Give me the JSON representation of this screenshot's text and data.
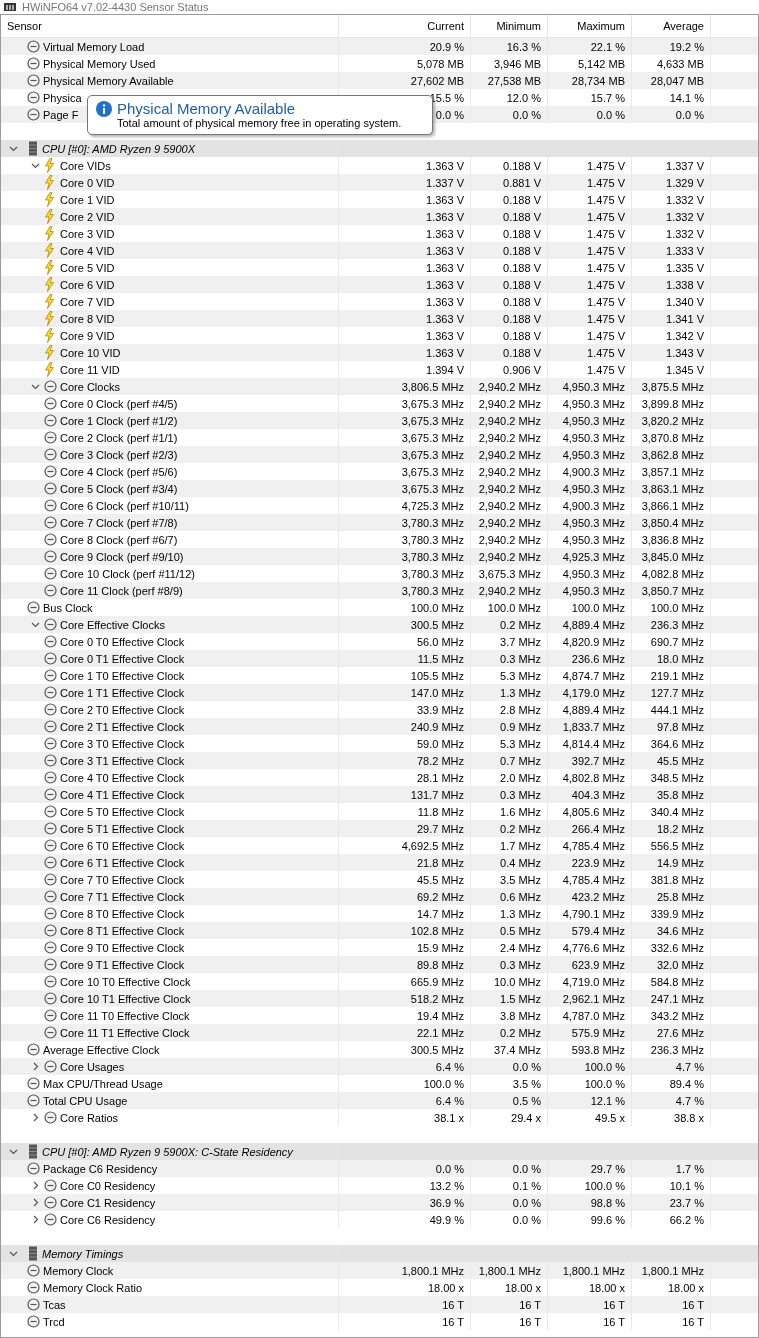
{
  "window": {
    "title": "HWiNFO64 v7.02-4430 Sensor Status"
  },
  "columns": [
    "Sensor",
    "Current",
    "Minimum",
    "Maximum",
    "Average"
  ],
  "sections": [
    {
      "items": [
        {
          "name": "Virtual Memory Load",
          "kind": "gauge",
          "values": [
            "20.9 %",
            "16.3 %",
            "22.1 %",
            "19.2 %"
          ]
        },
        {
          "name": "Physical Memory Used",
          "kind": "gauge",
          "values": [
            "5,078 MB",
            "3,946 MB",
            "5,142 MB",
            "4,633 MB"
          ]
        },
        {
          "name": "Physical Memory Available",
          "kind": "gauge",
          "values": [
            "27,602 MB",
            "27,538 MB",
            "28,734 MB",
            "28,047 MB"
          ]
        },
        {
          "name": "Physica",
          "kind": "gauge",
          "values": [
            "15.5 %",
            "12.0 %",
            "15.7 %",
            "14.1 %"
          ]
        },
        {
          "name": "Page F",
          "kind": "gauge",
          "values": [
            "0.0 %",
            "0.0 %",
            "0.0 %",
            "0.0 %"
          ]
        }
      ]
    },
    {
      "title": "CPU [#0]: AMD Ryzen 9 5900X",
      "expanded": true,
      "items": [
        {
          "name": "Core VIDs",
          "kind": "voltage",
          "expanded": true,
          "values": [
            "1.363 V",
            "0.188 V",
            "1.475 V",
            "1.337 V"
          ],
          "children": [
            {
              "name": "Core 0 VID",
              "kind": "voltage",
              "values": [
                "1.337 V",
                "0.881 V",
                "1.475 V",
                "1.329 V"
              ]
            },
            {
              "name": "Core 1 VID",
              "kind": "voltage",
              "values": [
                "1.363 V",
                "0.188 V",
                "1.475 V",
                "1.332 V"
              ]
            },
            {
              "name": "Core 2 VID",
              "kind": "voltage",
              "values": [
                "1.363 V",
                "0.188 V",
                "1.475 V",
                "1.332 V"
              ]
            },
            {
              "name": "Core 3 VID",
              "kind": "voltage",
              "values": [
                "1.363 V",
                "0.188 V",
                "1.475 V",
                "1.332 V"
              ]
            },
            {
              "name": "Core 4 VID",
              "kind": "voltage",
              "values": [
                "1.363 V",
                "0.188 V",
                "1.475 V",
                "1.333 V"
              ]
            },
            {
              "name": "Core 5 VID",
              "kind": "voltage",
              "values": [
                "1.363 V",
                "0.188 V",
                "1.475 V",
                "1.335 V"
              ]
            },
            {
              "name": "Core 6 VID",
              "kind": "voltage",
              "values": [
                "1.363 V",
                "0.188 V",
                "1.475 V",
                "1.338 V"
              ]
            },
            {
              "name": "Core 7 VID",
              "kind": "voltage",
              "values": [
                "1.363 V",
                "0.188 V",
                "1.475 V",
                "1.340 V"
              ]
            },
            {
              "name": "Core 8 VID",
              "kind": "voltage",
              "values": [
                "1.363 V",
                "0.188 V",
                "1.475 V",
                "1.341 V"
              ]
            },
            {
              "name": "Core 9 VID",
              "kind": "voltage",
              "values": [
                "1.363 V",
                "0.188 V",
                "1.475 V",
                "1.342 V"
              ]
            },
            {
              "name": "Core 10 VID",
              "kind": "voltage",
              "values": [
                "1.363 V",
                "0.188 V",
                "1.475 V",
                "1.343 V"
              ]
            },
            {
              "name": "Core 11 VID",
              "kind": "voltage",
              "values": [
                "1.394 V",
                "0.906 V",
                "1.475 V",
                "1.345 V"
              ]
            }
          ]
        },
        {
          "name": "Core Clocks",
          "kind": "gauge",
          "expanded": true,
          "values": [
            "3,806.5 MHz",
            "2,940.2 MHz",
            "4,950.3 MHz",
            "3,875.5 MHz"
          ],
          "children": [
            {
              "name": "Core 0 Clock (perf #4/5)",
              "kind": "gauge",
              "values": [
                "3,675.3 MHz",
                "2,940.2 MHz",
                "4,950.3 MHz",
                "3,899.8 MHz"
              ]
            },
            {
              "name": "Core 1 Clock (perf #1/2)",
              "kind": "gauge",
              "values": [
                "3,675.3 MHz",
                "2,940.2 MHz",
                "4,950.3 MHz",
                "3,820.2 MHz"
              ]
            },
            {
              "name": "Core 2 Clock (perf #1/1)",
              "kind": "gauge",
              "values": [
                "3,675.3 MHz",
                "2,940.2 MHz",
                "4,950.3 MHz",
                "3,870.8 MHz"
              ]
            },
            {
              "name": "Core 3 Clock (perf #2/3)",
              "kind": "gauge",
              "values": [
                "3,675.3 MHz",
                "2,940.2 MHz",
                "4,950.3 MHz",
                "3,862.8 MHz"
              ]
            },
            {
              "name": "Core 4 Clock (perf #5/6)",
              "kind": "gauge",
              "values": [
                "3,675.3 MHz",
                "2,940.2 MHz",
                "4,900.3 MHz",
                "3,857.1 MHz"
              ]
            },
            {
              "name": "Core 5 Clock (perf #3/4)",
              "kind": "gauge",
              "values": [
                "3,675.3 MHz",
                "2,940.2 MHz",
                "4,950.3 MHz",
                "3,863.1 MHz"
              ]
            },
            {
              "name": "Core 6 Clock (perf #10/11)",
              "kind": "gauge",
              "values": [
                "4,725.3 MHz",
                "2,940.2 MHz",
                "4,900.3 MHz",
                "3,866.1 MHz"
              ]
            },
            {
              "name": "Core 7 Clock (perf #7/8)",
              "kind": "gauge",
              "values": [
                "3,780.3 MHz",
                "2,940.2 MHz",
                "4,950.3 MHz",
                "3,850.4 MHz"
              ]
            },
            {
              "name": "Core 8 Clock (perf #6/7)",
              "kind": "gauge",
              "values": [
                "3,780.3 MHz",
                "2,940.2 MHz",
                "4,950.3 MHz",
                "3,836.8 MHz"
              ]
            },
            {
              "name": "Core 9 Clock (perf #9/10)",
              "kind": "gauge",
              "values": [
                "3,780.3 MHz",
                "2,940.2 MHz",
                "4,925.3 MHz",
                "3,845.0 MHz"
              ]
            },
            {
              "name": "Core 10 Clock (perf #11/12)",
              "kind": "gauge",
              "values": [
                "3,780.3 MHz",
                "3,675.3 MHz",
                "4,950.3 MHz",
                "4,082.8 MHz"
              ]
            },
            {
              "name": "Core 11 Clock (perf #8/9)",
              "kind": "gauge",
              "values": [
                "3,780.3 MHz",
                "2,940.2 MHz",
                "4,950.3 MHz",
                "3,850.7 MHz"
              ]
            }
          ]
        },
        {
          "name": "Bus Clock",
          "kind": "gauge",
          "values": [
            "100.0 MHz",
            "100.0 MHz",
            "100.0 MHz",
            "100.0 MHz"
          ]
        },
        {
          "name": "Core Effective Clocks",
          "kind": "gauge",
          "expanded": true,
          "values": [
            "300.5 MHz",
            "0.2 MHz",
            "4,889.4 MHz",
            "236.3 MHz"
          ],
          "children": [
            {
              "name": "Core 0 T0 Effective Clock",
              "kind": "gauge",
              "values": [
                "56.0 MHz",
                "3.7 MHz",
                "4,820.9 MHz",
                "690.7 MHz"
              ]
            },
            {
              "name": "Core 0 T1 Effective Clock",
              "kind": "gauge",
              "values": [
                "11.5 MHz",
                "0.3 MHz",
                "236.6 MHz",
                "18.0 MHz"
              ]
            },
            {
              "name": "Core 1 T0 Effective Clock",
              "kind": "gauge",
              "values": [
                "105.5 MHz",
                "5.3 MHz",
                "4,874.7 MHz",
                "219.1 MHz"
              ]
            },
            {
              "name": "Core 1 T1 Effective Clock",
              "kind": "gauge",
              "values": [
                "147.0 MHz",
                "1.3 MHz",
                "4,179.0 MHz",
                "127.7 MHz"
              ]
            },
            {
              "name": "Core 2 T0 Effective Clock",
              "kind": "gauge",
              "values": [
                "33.9 MHz",
                "2.8 MHz",
                "4,889.4 MHz",
                "444.1 MHz"
              ]
            },
            {
              "name": "Core 2 T1 Effective Clock",
              "kind": "gauge",
              "values": [
                "240.9 MHz",
                "0.9 MHz",
                "1,833.7 MHz",
                "97.8 MHz"
              ]
            },
            {
              "name": "Core 3 T0 Effective Clock",
              "kind": "gauge",
              "values": [
                "59.0 MHz",
                "5.3 MHz",
                "4,814.4 MHz",
                "364.6 MHz"
              ]
            },
            {
              "name": "Core 3 T1 Effective Clock",
              "kind": "gauge",
              "values": [
                "78.2 MHz",
                "0.7 MHz",
                "392.7 MHz",
                "45.5 MHz"
              ]
            },
            {
              "name": "Core 4 T0 Effective Clock",
              "kind": "gauge",
              "values": [
                "28.1 MHz",
                "2.0 MHz",
                "4,802.8 MHz",
                "348.5 MHz"
              ]
            },
            {
              "name": "Core 4 T1 Effective Clock",
              "kind": "gauge",
              "values": [
                "131.7 MHz",
                "0.3 MHz",
                "404.3 MHz",
                "35.8 MHz"
              ]
            },
            {
              "name": "Core 5 T0 Effective Clock",
              "kind": "gauge",
              "values": [
                "11.8 MHz",
                "1.6 MHz",
                "4,805.6 MHz",
                "340.4 MHz"
              ]
            },
            {
              "name": "Core 5 T1 Effective Clock",
              "kind": "gauge",
              "values": [
                "29.7 MHz",
                "0.2 MHz",
                "266.4 MHz",
                "18.2 MHz"
              ]
            },
            {
              "name": "Core 6 T0 Effective Clock",
              "kind": "gauge",
              "values": [
                "4,692.5 MHz",
                "1.7 MHz",
                "4,785.4 MHz",
                "556.5 MHz"
              ]
            },
            {
              "name": "Core 6 T1 Effective Clock",
              "kind": "gauge",
              "values": [
                "21.8 MHz",
                "0.4 MHz",
                "223.9 MHz",
                "14.9 MHz"
              ]
            },
            {
              "name": "Core 7 T0 Effective Clock",
              "kind": "gauge",
              "values": [
                "45.5 MHz",
                "3.5 MHz",
                "4,785.4 MHz",
                "381.8 MHz"
              ]
            },
            {
              "name": "Core 7 T1 Effective Clock",
              "kind": "gauge",
              "values": [
                "69.2 MHz",
                "0.6 MHz",
                "423.2 MHz",
                "25.8 MHz"
              ]
            },
            {
              "name": "Core 8 T0 Effective Clock",
              "kind": "gauge",
              "values": [
                "14.7 MHz",
                "1.3 MHz",
                "4,790.1 MHz",
                "339.9 MHz"
              ]
            },
            {
              "name": "Core 8 T1 Effective Clock",
              "kind": "gauge",
              "values": [
                "102.8 MHz",
                "0.5 MHz",
                "579.4 MHz",
                "34.6 MHz"
              ]
            },
            {
              "name": "Core 9 T0 Effective Clock",
              "kind": "gauge",
              "values": [
                "15.9 MHz",
                "2.4 MHz",
                "4,776.6 MHz",
                "332.6 MHz"
              ]
            },
            {
              "name": "Core 9 T1 Effective Clock",
              "kind": "gauge",
              "values": [
                "89.8 MHz",
                "0.3 MHz",
                "623.9 MHz",
                "32.0 MHz"
              ]
            },
            {
              "name": "Core 10 T0 Effective Clock",
              "kind": "gauge",
              "values": [
                "665.9 MHz",
                "10.0 MHz",
                "4,719.0 MHz",
                "584.8 MHz"
              ]
            },
            {
              "name": "Core 10 T1 Effective Clock",
              "kind": "gauge",
              "values": [
                "518.2 MHz",
                "1.5 MHz",
                "2,962.1 MHz",
                "247.1 MHz"
              ]
            },
            {
              "name": "Core 11 T0 Effective Clock",
              "kind": "gauge",
              "values": [
                "19.4 MHz",
                "3.8 MHz",
                "4,787.0 MHz",
                "343.2 MHz"
              ]
            },
            {
              "name": "Core 11 T1 Effective Clock",
              "kind": "gauge",
              "values": [
                "22.1 MHz",
                "0.2 MHz",
                "575.9 MHz",
                "27.6 MHz"
              ]
            }
          ]
        },
        {
          "name": "Average Effective Clock",
          "kind": "gauge",
          "values": [
            "300.5 MHz",
            "37.4 MHz",
            "593.8 MHz",
            "236.3 MHz"
          ]
        },
        {
          "name": "Core Usages",
          "kind": "gauge",
          "expanded": false,
          "values": [
            "6.4 %",
            "0.0 %",
            "100.0 %",
            "4.7 %"
          ]
        },
        {
          "name": "Max CPU/Thread Usage",
          "kind": "gauge",
          "values": [
            "100.0 %",
            "3.5 %",
            "100.0 %",
            "89.4 %"
          ]
        },
        {
          "name": "Total CPU Usage",
          "kind": "gauge",
          "values": [
            "6.4 %",
            "0.5 %",
            "12.1 %",
            "4.7 %"
          ]
        },
        {
          "name": "Core Ratios",
          "kind": "gauge",
          "expanded": false,
          "values": [
            "38.1 x",
            "29.4 x",
            "49.5 x",
            "38.8 x"
          ]
        }
      ]
    },
    {
      "title": "CPU [#0]: AMD Ryzen 9 5900X: C-State Residency",
      "expanded": true,
      "items": [
        {
          "name": "Package C6 Residency",
          "kind": "gauge",
          "values": [
            "0.0 %",
            "0.0 %",
            "29.7 %",
            "1.7 %"
          ]
        },
        {
          "name": "Core C0 Residency",
          "kind": "gauge",
          "expanded": false,
          "values": [
            "13.2 %",
            "0.1 %",
            "100.0 %",
            "10.1 %"
          ]
        },
        {
          "name": "Core C1 Residency",
          "kind": "gauge",
          "expanded": false,
          "values": [
            "36.9 %",
            "0.0 %",
            "98.8 %",
            "23.7 %"
          ]
        },
        {
          "name": "Core C6 Residency",
          "kind": "gauge",
          "expanded": false,
          "values": [
            "49.9 %",
            "0.0 %",
            "99.6 %",
            "66.2 %"
          ]
        }
      ]
    },
    {
      "title": "Memory Timings",
      "expanded": true,
      "items": [
        {
          "name": "Memory Clock",
          "kind": "gauge",
          "values": [
            "1,800.1 MHz",
            "1,800.1 MHz",
            "1,800.1 MHz",
            "1,800.1 MHz"
          ]
        },
        {
          "name": "Memory Clock Ratio",
          "kind": "gauge",
          "values": [
            "18.00 x",
            "18.00 x",
            "18.00 x",
            "18.00 x"
          ]
        },
        {
          "name": "Tcas",
          "kind": "gauge",
          "values": [
            "16 T",
            "16 T",
            "16 T",
            "16 T"
          ]
        },
        {
          "name": "Trcd",
          "kind": "gauge",
          "values": [
            "16 T",
            "16 T",
            "16 T",
            "16 T"
          ]
        }
      ]
    }
  ],
  "tooltip": {
    "title": "Physical Memory Available",
    "text": "Total amount of physical memory free in operating system."
  }
}
